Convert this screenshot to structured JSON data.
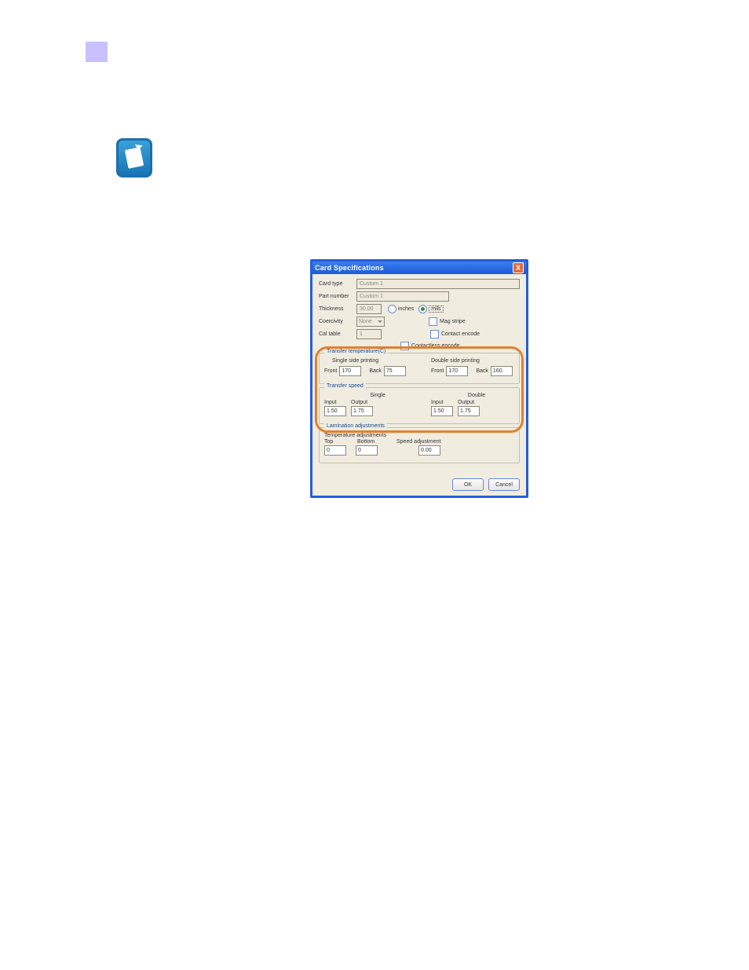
{
  "page": {
    "number": ""
  },
  "dialog": {
    "title": "Card Specifications",
    "close": "X",
    "labels": {
      "card_type": "Card type",
      "part_number": "Part number",
      "thickness": "Thickness",
      "coercivity": "Coercivity",
      "cal_table": "Cal table"
    },
    "values": {
      "card_type": "Custom 1",
      "part_number": "Custom 1",
      "thickness": "30.00",
      "coercivity": "None",
      "cal_table": "1"
    },
    "units": {
      "inches": "inches",
      "mils": "mils"
    },
    "checks": {
      "mag": "Mag stripe",
      "contact": "Contact encode",
      "contactless": "Contactless encode"
    },
    "transfer_temp": {
      "title": "Transfer temperature(C)",
      "single": "Single side printing",
      "double": "Double side printing",
      "front": "Front",
      "back": "Back",
      "vals": {
        "s_front": "170",
        "s_back": "75",
        "d_front": "170",
        "d_back": "160"
      }
    },
    "transfer_speed": {
      "title": "Transfer speed",
      "single": "Single",
      "double": "Double",
      "input": "Input",
      "output": "Output",
      "vals": {
        "s_in": "1.50",
        "s_out": "1.75",
        "d_in": "1.50",
        "d_out": "1.75"
      }
    },
    "lamination": {
      "title": "Lamination adjustments",
      "temp_adj": "Temperature adjustments",
      "top": "Top",
      "bottom": "Bottom",
      "speed_adj": "Speed adjustment",
      "vals": {
        "top": "0",
        "bottom": "0",
        "speed": "0.00"
      }
    },
    "buttons": {
      "ok": "OK",
      "cancel": "Cancel"
    }
  }
}
